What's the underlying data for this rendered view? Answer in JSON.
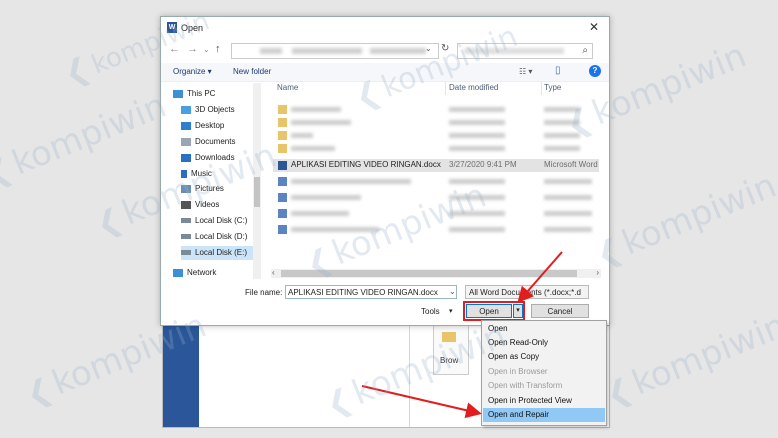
{
  "dialog": {
    "title": "Open",
    "close_icon": "close-icon"
  },
  "nav": {
    "back": "←",
    "forward": "→",
    "down": "⌄",
    "up": "↑",
    "refresh": "↻",
    "dropdown": "⌄",
    "search_icon": "⌕"
  },
  "toolbar": {
    "organize": "Organize ▾",
    "new_folder": "New folder",
    "view_icon": "☷ ▾",
    "pane_icon": "▯",
    "help": "?"
  },
  "sidebar": {
    "items": [
      {
        "label": "This PC",
        "icon": "pc-icon",
        "color": "#3d8fd6"
      },
      {
        "label": "3D Objects",
        "icon": "cube-icon",
        "color": "#4a9fe0"
      },
      {
        "label": "Desktop",
        "icon": "desktop-icon",
        "color": "#2e7fd0"
      },
      {
        "label": "Documents",
        "icon": "documents-icon",
        "color": "#9aa6b2"
      },
      {
        "label": "Downloads",
        "icon": "download-icon",
        "color": "#2b6fc0"
      },
      {
        "label": "Music",
        "icon": "music-icon",
        "color": "#2b6fc0"
      },
      {
        "label": "Pictures",
        "icon": "pictures-icon",
        "color": "#6a8fb5"
      },
      {
        "label": "Videos",
        "icon": "videos-icon",
        "color": "#555"
      },
      {
        "label": "Local Disk (C:)",
        "icon": "disk-icon",
        "color": "#7a8a99"
      },
      {
        "label": "Local Disk (D:)",
        "icon": "disk-icon",
        "color": "#7a8a99"
      },
      {
        "label": "Local Disk (E:)",
        "icon": "disk-icon",
        "color": "#7a8a99"
      },
      {
        "label": "Network",
        "icon": "network-icon",
        "color": "#3d8fd6"
      }
    ]
  },
  "files": {
    "columns": {
      "name": "Name",
      "date": "Date modified",
      "type": "Type"
    },
    "selected": {
      "name": "APLIKASI EDITING VIDEO RINGAN.docx",
      "date": "3/27/2020 9:41 PM",
      "type": "Microsoft Word"
    }
  },
  "footer": {
    "file_name_label": "File name:",
    "file_name_value": "APLIKASI EDITING VIDEO RINGAN.docx",
    "filter": "All Word Documents (*.docx;*.d",
    "tools": "Tools",
    "open": "Open",
    "cancel": "Cancel"
  },
  "background": {
    "browse": "Brow"
  },
  "open_menu": {
    "items": [
      {
        "label": "Open",
        "enabled": true
      },
      {
        "label": "Open Read-Only",
        "enabled": true
      },
      {
        "label": "Open as Copy",
        "enabled": true
      },
      {
        "label": "Open in Browser",
        "enabled": false
      },
      {
        "label": "Open with Transform",
        "enabled": false
      },
      {
        "label": "Open in Protected View",
        "enabled": true
      },
      {
        "label": "Open and Repair",
        "enabled": true
      }
    ]
  },
  "watermark": "kompiwin",
  "colors": {
    "accent": "#0078d7",
    "highlight": "#e21d1d",
    "word_blue": "#2b579a"
  }
}
